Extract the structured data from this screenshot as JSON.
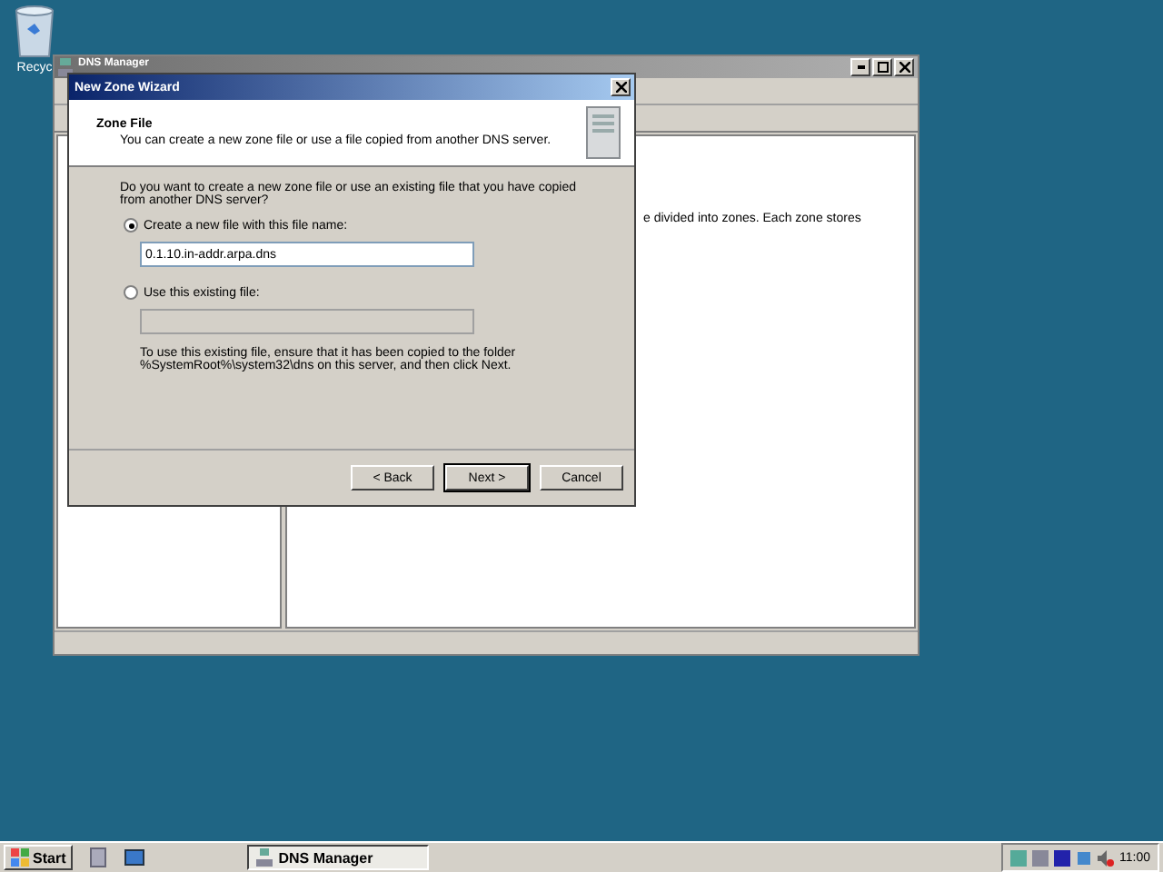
{
  "desktop": {
    "icons": [
      {
        "label": "Recyc"
      }
    ]
  },
  "dns_manager": {
    "title": "DNS Manager",
    "content_text": "e divided into zones. Each zone stores"
  },
  "wizard": {
    "title": "New Zone Wizard",
    "header": {
      "title": "Zone File",
      "subtitle": "You can create a new zone file or use a file copied from another DNS server."
    },
    "question": "Do you want to create a new zone file or use an existing file that you have copied\nfrom another DNS server?",
    "options": [
      {
        "label": "Create a new file with this file name:",
        "selected": true,
        "field": {
          "value": "0.1.10.in-addr.arpa.dns",
          "disabled": false
        }
      },
      {
        "label": "Use this existing file:",
        "selected": false,
        "field": {
          "disabled": true
        }
      }
    ],
    "note": "To use this existing file, ensure that it has been copied to the folder\n%SystemRoot%\\system32\\dns on this server, and then click Next.",
    "buttons": [
      {
        "label": "< Back",
        "default": false
      },
      {
        "label": "Next >",
        "default": true
      },
      {
        "label": "Cancel",
        "default": false
      }
    ]
  },
  "taskbar": {
    "start": "Start",
    "tasks": [
      {
        "label": "DNS Manager",
        "selected": true
      }
    ],
    "clock": "11:00"
  }
}
